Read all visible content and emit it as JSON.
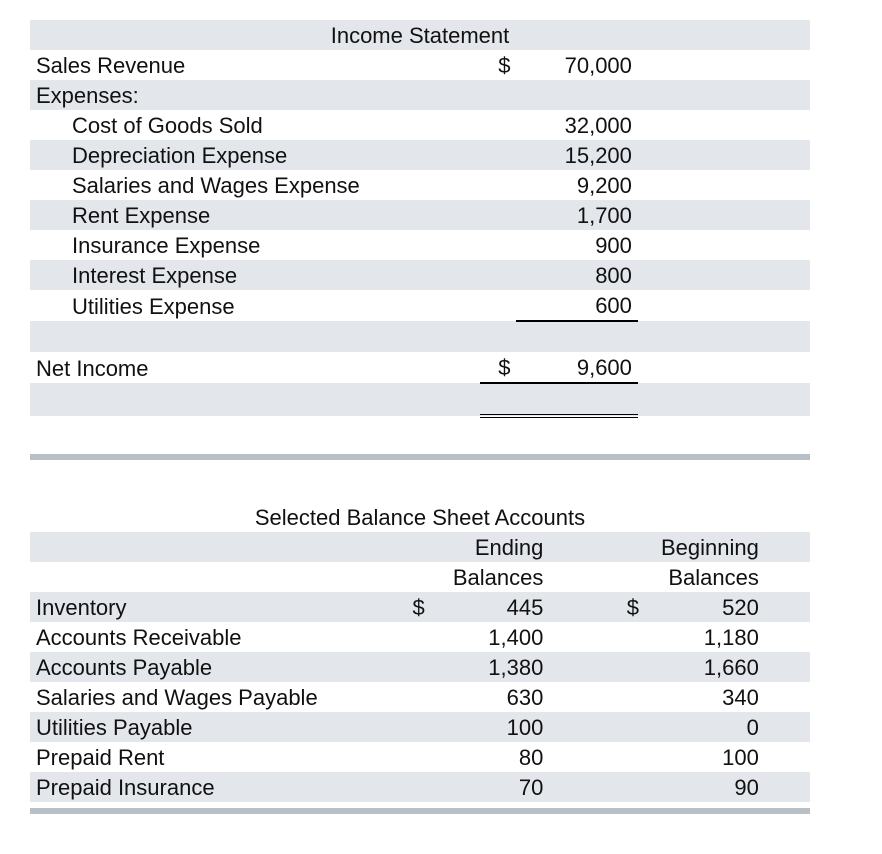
{
  "income_statement": {
    "title": "Income Statement",
    "sales_label": "Sales Revenue",
    "sales_sym": "$",
    "sales_value": "70,000",
    "expenses_header": "Expenses:",
    "items": [
      {
        "label": "Cost of Goods Sold",
        "value": "32,000"
      },
      {
        "label": "Depreciation Expense",
        "value": "15,200"
      },
      {
        "label": "Salaries and Wages Expense",
        "value": "9,200"
      },
      {
        "label": "Rent Expense",
        "value": "1,700"
      },
      {
        "label": "Insurance Expense",
        "value": "900"
      },
      {
        "label": "Interest Expense",
        "value": "800"
      },
      {
        "label": "Utilities Expense",
        "value": "600"
      }
    ],
    "net_label": "Net Income",
    "net_sym": "$",
    "net_value": "9,600"
  },
  "balance_sheet": {
    "title": "Selected Balance Sheet Accounts",
    "col1a": "Ending",
    "col1b": "Balances",
    "col2a": "Beginning",
    "col2b": "Balances",
    "sym": "$",
    "rows": [
      {
        "label": "Inventory",
        "end": "445",
        "beg": "520"
      },
      {
        "label": "Accounts Receivable",
        "end": "1,400",
        "beg": "1,180"
      },
      {
        "label": "Accounts Payable",
        "end": "1,380",
        "beg": "1,660"
      },
      {
        "label": "Salaries and Wages Payable",
        "end": "630",
        "beg": "340"
      },
      {
        "label": "Utilities Payable",
        "end": "100",
        "beg": "0"
      },
      {
        "label": "Prepaid Rent",
        "end": "80",
        "beg": "100"
      },
      {
        "label": "Prepaid Insurance",
        "end": "70",
        "beg": "90"
      }
    ]
  }
}
